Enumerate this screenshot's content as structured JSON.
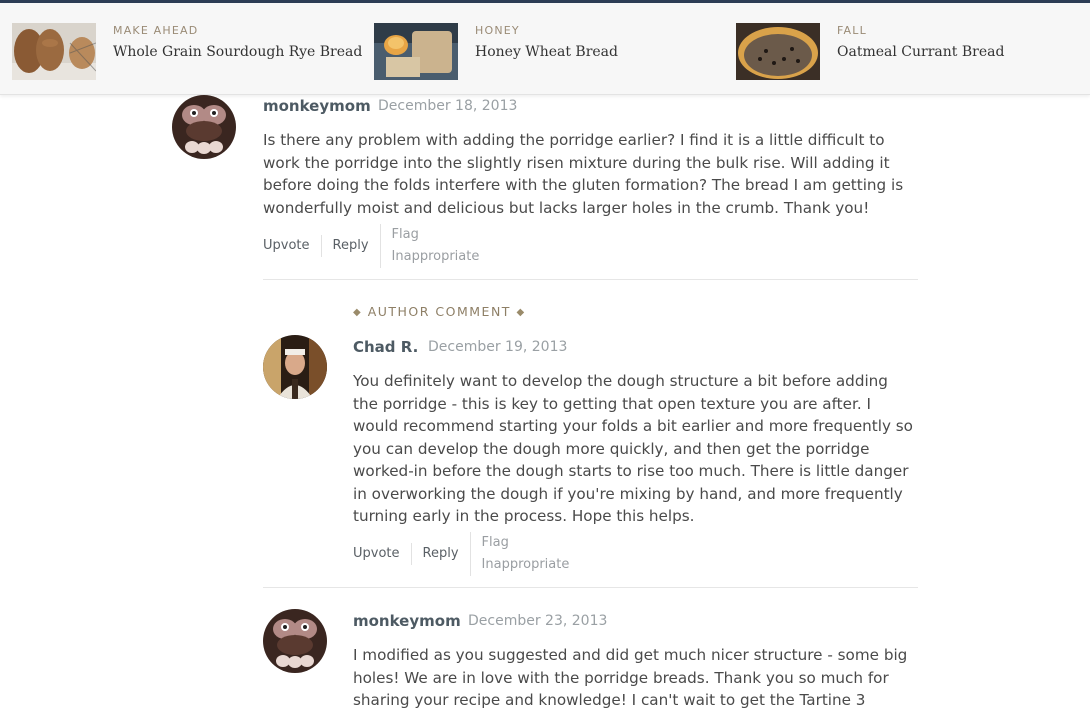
{
  "recommended": [
    {
      "category": "MAKE AHEAD",
      "title": "Whole Grain Sourdough Rye Bread"
    },
    {
      "category": "HONEY",
      "title": "Honey Wheat Bread"
    },
    {
      "category": "FALL",
      "title": "Oatmeal Currant Bread"
    }
  ],
  "comments": [
    {
      "author": "monkeymom",
      "date": "December 18, 2013",
      "body": "Is there any problem with adding the porridge earlier? I find it is a little difficult to work the porridge into the slightly risen mixture during the bulk rise. Will adding it before doing the folds interfere with the gluten formation? The bread I am getting is wonderfully moist and delicious but lacks larger holes in the crumb. Thank you!",
      "actions": {
        "upvote": "Upvote",
        "reply": "Reply",
        "flag": "Flag Inappropriate"
      }
    },
    {
      "badge": "AUTHOR COMMENT",
      "author": "Chad R.",
      "date": "December 19, 2013",
      "body": "You definitely want to develop the dough structure a bit before adding the porridge - this is key to getting that open texture you are after. I would recommend starting your folds a bit earlier and more frequently so you can develop the dough more quickly, and then get the porridge worked-in before the dough starts to rise too much. There is little danger in overworking the dough if you're mixing by hand, and more frequently turning early in the process. Hope this helps.",
      "actions": {
        "upvote": "Upvote",
        "reply": "Reply",
        "flag": "Flag Inappropriate"
      }
    },
    {
      "author": "monkeymom",
      "date": "December 23, 2013",
      "body": "I modified as you suggested and did get much nicer structure - some big holes! We are in love with the porridge breads. Thank you so much for sharing your recipe and knowledge! I can't wait to get the Tartine 3"
    }
  ],
  "colors": {
    "top_border": "#2d3d55",
    "category_text": "#9a8b76",
    "badge_text": "#8e7f66"
  }
}
